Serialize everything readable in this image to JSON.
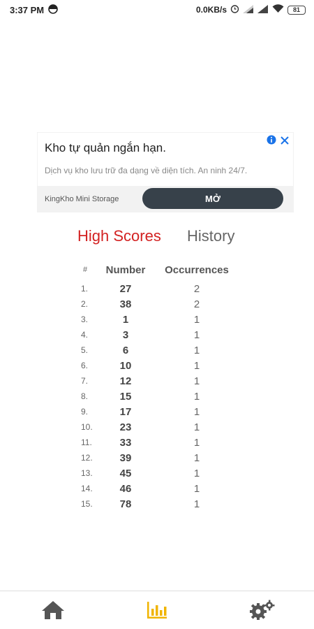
{
  "status_bar": {
    "time": "3:37 PM",
    "network_speed": "0.0KB/s",
    "battery": "81",
    "icons": [
      "sync-icon",
      "alarm-icon",
      "signal-icon",
      "signal-icon",
      "wifi-icon",
      "battery-icon"
    ]
  },
  "ad": {
    "title": "Kho tự quản ngắn hạn.",
    "description": "Dịch vụ kho lưu trữ đa dạng về diện tích. An ninh 24/7.",
    "brand": "KingKho Mini Storage",
    "cta": "MỞ",
    "icons": [
      "info-icon",
      "close-icon"
    ]
  },
  "tabs": {
    "high_scores": "High Scores",
    "history": "History",
    "active": "high_scores",
    "active_color": "#d32222"
  },
  "table": {
    "headers": {
      "index": "#",
      "number": "Number",
      "occurrences": "Occurrences"
    },
    "rows": [
      {
        "idx": "1.",
        "number": "27",
        "occ": "2"
      },
      {
        "idx": "2.",
        "number": "38",
        "occ": "2"
      },
      {
        "idx": "3.",
        "number": "1",
        "occ": "1"
      },
      {
        "idx": "4.",
        "number": "3",
        "occ": "1"
      },
      {
        "idx": "5.",
        "number": "6",
        "occ": "1"
      },
      {
        "idx": "6.",
        "number": "10",
        "occ": "1"
      },
      {
        "idx": "7.",
        "number": "12",
        "occ": "1"
      },
      {
        "idx": "8.",
        "number": "15",
        "occ": "1"
      },
      {
        "idx": "9.",
        "number": "17",
        "occ": "1"
      },
      {
        "idx": "10.",
        "number": "23",
        "occ": "1"
      },
      {
        "idx": "11.",
        "number": "33",
        "occ": "1"
      },
      {
        "idx": "12.",
        "number": "39",
        "occ": "1"
      },
      {
        "idx": "13.",
        "number": "45",
        "occ": "1"
      },
      {
        "idx": "14.",
        "number": "46",
        "occ": "1"
      },
      {
        "idx": "15.",
        "number": "78",
        "occ": "1"
      }
    ]
  },
  "bottom_nav": {
    "items": [
      "home-icon",
      "bar-chart-icon",
      "gears-icon"
    ],
    "active": "bar-chart-icon",
    "active_color": "#f0b400",
    "inactive_color": "#555555"
  }
}
